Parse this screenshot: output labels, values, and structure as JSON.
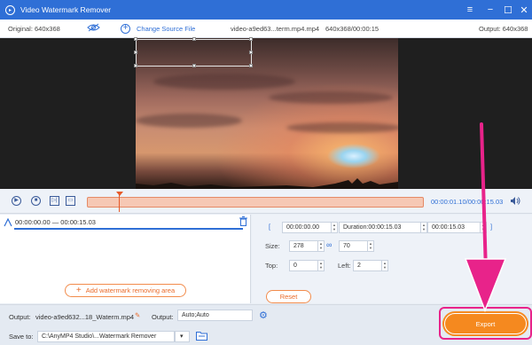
{
  "window": {
    "title": "Video Watermark Remover"
  },
  "info": {
    "original": "Original: 640x368",
    "change_source": "Change Source File",
    "filename": "video-a9ed63...term.mp4.mp4",
    "meta": "640x368/00:00:15",
    "output": "Output: 640x368"
  },
  "timeline": {
    "time": "00:00:01.10/00:00:15.03"
  },
  "segment": {
    "range": "00:00:00.00 — 00:00:15.03"
  },
  "add_area_label": "Add watermark removing area",
  "settings": {
    "start": "00:00:00.00",
    "duration": "Duration:00:00:15.03",
    "end": "00:00:15.03",
    "size_label": "Size:",
    "width": "278",
    "height": "70",
    "top_label": "Top:",
    "top": "0",
    "left_label": "Left:",
    "left": "2",
    "reset_label": "Reset"
  },
  "bottom": {
    "output_label": "Output:",
    "output_file": "video-a9ed632...18_Waterm.mp4",
    "output2_label": "Output:",
    "output_format": "Auto;Auto",
    "save_label": "Save to:",
    "save_path": "C:\\AnyMP4 Studio\\...Watermark Remover",
    "export_label": "Export"
  },
  "colors": {
    "accent": "#2f6fd6",
    "export": "#f5891f",
    "highlight": "#e8238a"
  }
}
